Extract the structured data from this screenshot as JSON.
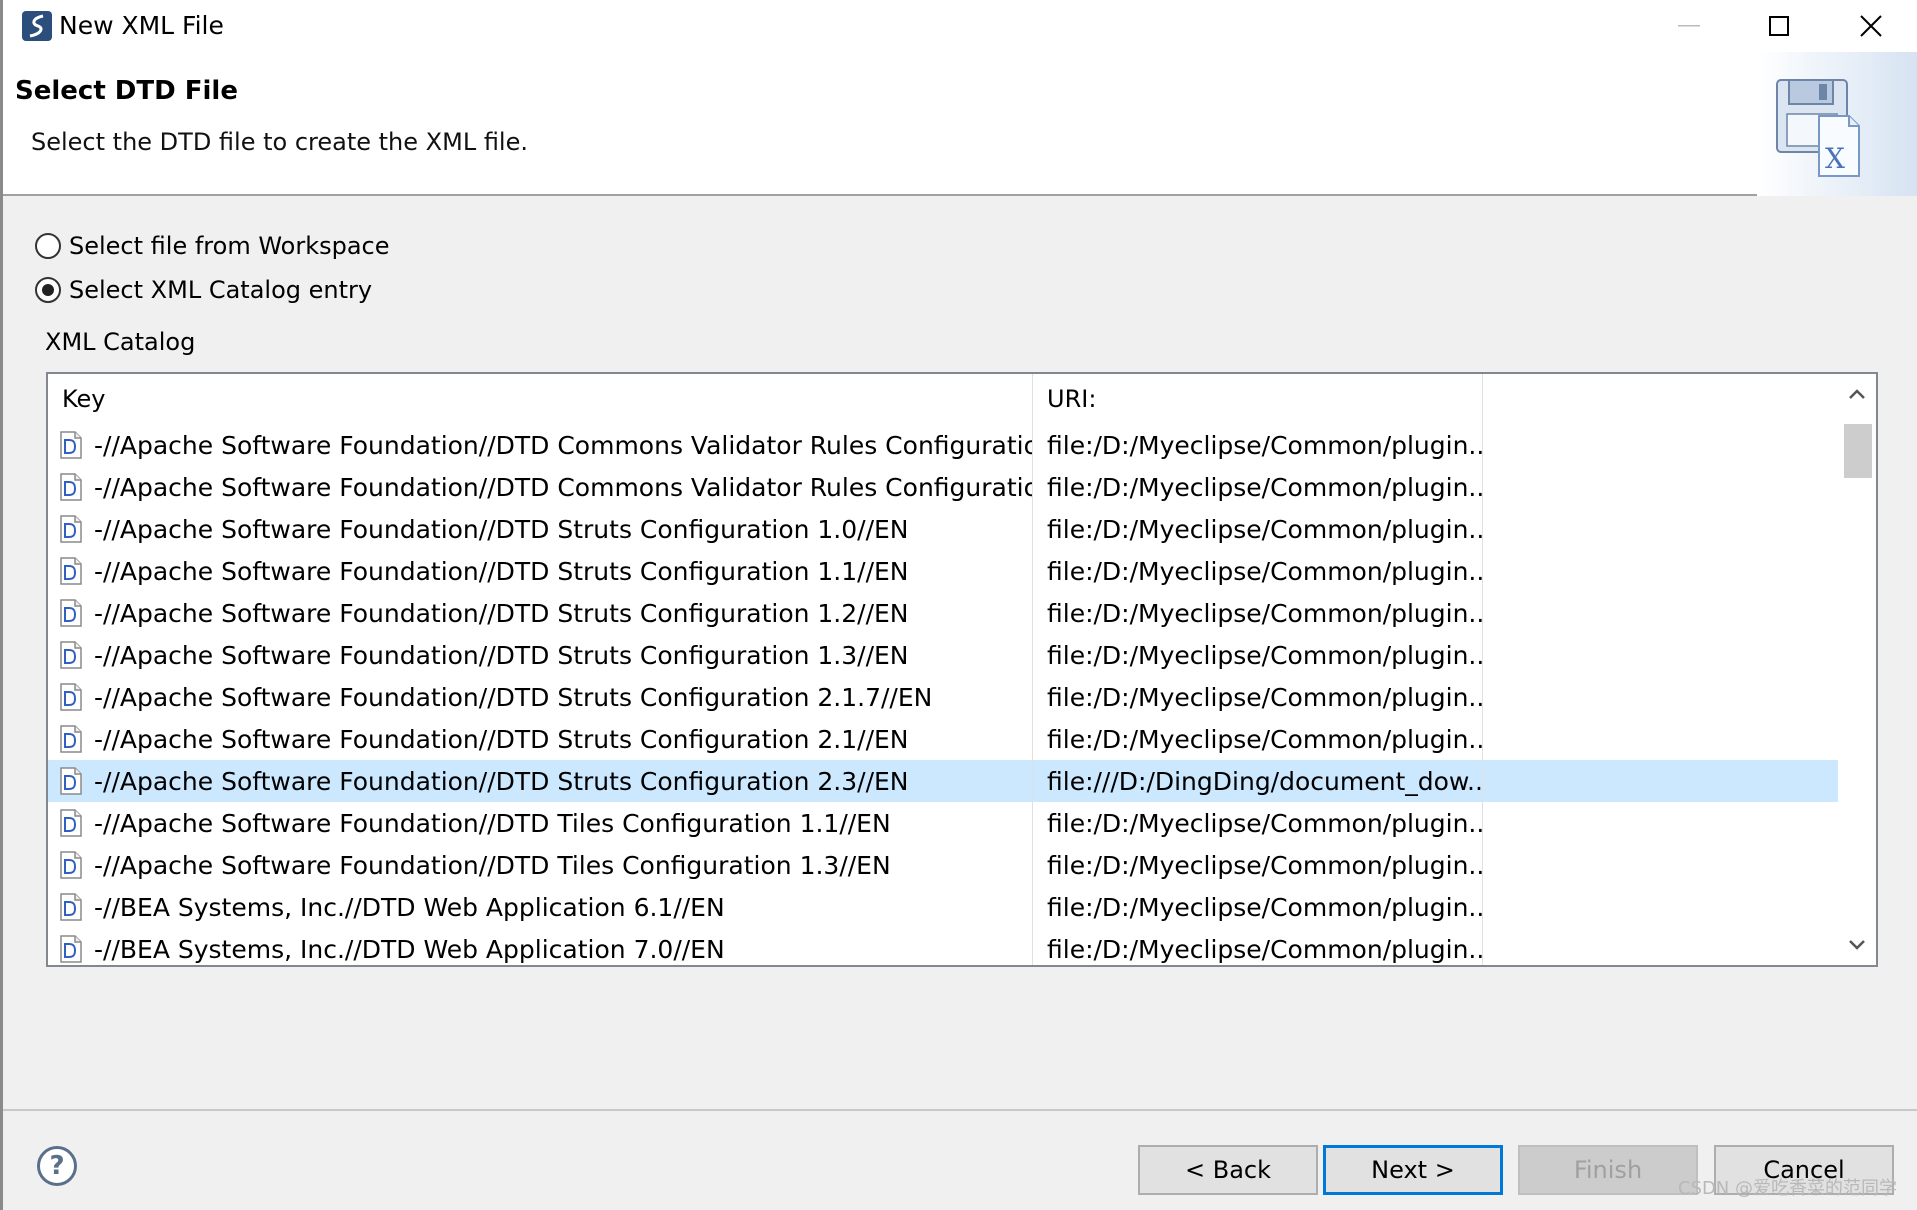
{
  "window": {
    "title": "New XML File",
    "icon": "myeclipse-icon"
  },
  "banner": {
    "title": "Select DTD File",
    "description": "Select the DTD file to create the XML file.",
    "image": "xml-file-wizard-icon"
  },
  "options": [
    {
      "label": "Select file from Workspace",
      "checked": false
    },
    {
      "label": "Select XML Catalog entry",
      "checked": true
    }
  ],
  "catalog": {
    "label": "XML Catalog",
    "columns": {
      "key": "Key",
      "uri": "URI:"
    },
    "rows": [
      {
        "key": "-//Apache Software Foundation//DTD Commons Validator Rules Configuration...",
        "uri": "file:/D:/Myeclipse/Common/plugin..."
      },
      {
        "key": "-//Apache Software Foundation//DTD Commons Validator Rules Configuration...",
        "uri": "file:/D:/Myeclipse/Common/plugin..."
      },
      {
        "key": "-//Apache Software Foundation//DTD Struts Configuration 1.0//EN",
        "uri": "file:/D:/Myeclipse/Common/plugin..."
      },
      {
        "key": "-//Apache Software Foundation//DTD Struts Configuration 1.1//EN",
        "uri": "file:/D:/Myeclipse/Common/plugin..."
      },
      {
        "key": "-//Apache Software Foundation//DTD Struts Configuration 1.2//EN",
        "uri": "file:/D:/Myeclipse/Common/plugin..."
      },
      {
        "key": "-//Apache Software Foundation//DTD Struts Configuration 1.3//EN",
        "uri": "file:/D:/Myeclipse/Common/plugin..."
      },
      {
        "key": "-//Apache Software Foundation//DTD Struts Configuration 2.1.7//EN",
        "uri": "file:/D:/Myeclipse/Common/plugin..."
      },
      {
        "key": "-//Apache Software Foundation//DTD Struts Configuration 2.1//EN",
        "uri": "file:/D:/Myeclipse/Common/plugin..."
      },
      {
        "key": "-//Apache Software Foundation//DTD Struts Configuration 2.3//EN",
        "uri": "file:///D:/DingDing/document_dow...",
        "selected": true
      },
      {
        "key": "-//Apache Software Foundation//DTD Tiles Configuration 1.1//EN",
        "uri": "file:/D:/Myeclipse/Common/plugin..."
      },
      {
        "key": "-//Apache Software Foundation//DTD Tiles Configuration 1.3//EN",
        "uri": "file:/D:/Myeclipse/Common/plugin..."
      },
      {
        "key": "-//BEA Systems, Inc.//DTD Web Application 6.1//EN",
        "uri": "file:/D:/Myeclipse/Common/plugin..."
      },
      {
        "key": "-//BEA Systems, Inc.//DTD Web Application 7.0//EN",
        "uri": "file:/D:/Myeclipse/Common/plugin..."
      }
    ]
  },
  "buttons": {
    "help": "?",
    "back": "< Back",
    "next": "Next >",
    "finish": "Finish",
    "cancel": "Cancel"
  },
  "watermark": "CSDN @爱吃香菜的范同学",
  "colors": {
    "selection": "#cce8ff",
    "default_button_border": "#0078d7"
  }
}
